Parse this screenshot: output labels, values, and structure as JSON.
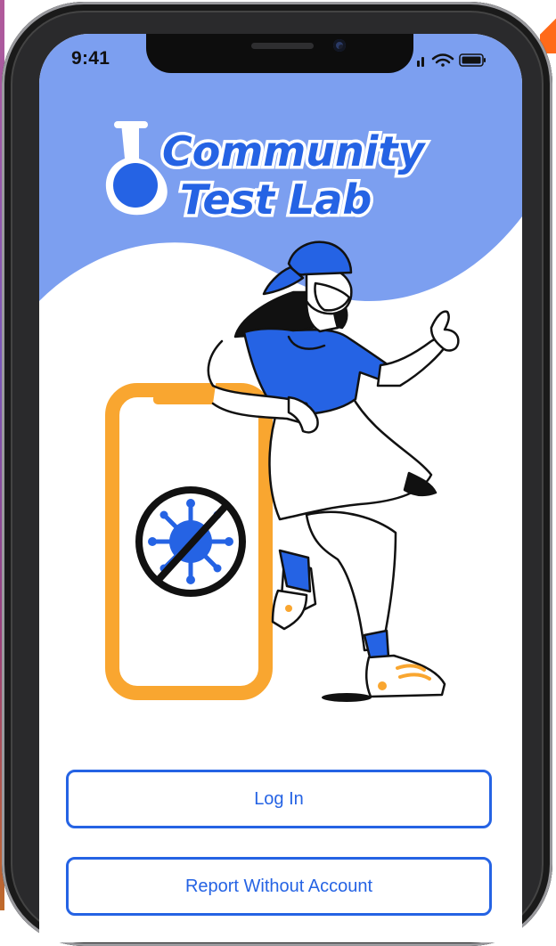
{
  "status_bar": {
    "time": "9:41"
  },
  "logo": {
    "line1": "Community",
    "line2": "Test Lab"
  },
  "actions": {
    "login_label": "Log In",
    "report_label": "Report Without Account"
  },
  "colors": {
    "header_blue": "#7c9ff0",
    "brand_blue": "#2563e4",
    "phone_orange": "#f9a630",
    "ink": "#111111"
  },
  "icons": [
    "flask-icon",
    "no-virus-icon",
    "wifi-icon",
    "battery-icon",
    "signal-icon"
  ]
}
